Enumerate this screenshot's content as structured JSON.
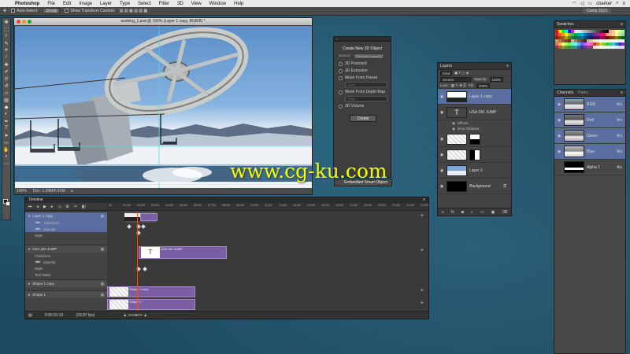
{
  "menubar": {
    "apple": "",
    "items": [
      "Photoshop",
      "File",
      "Edit",
      "Image",
      "Layer",
      "Type",
      "Select",
      "Filter",
      "3D",
      "View",
      "Window",
      "Help"
    ],
    "user": "cbarker"
  },
  "options": {
    "auto_select": "Auto-Select:",
    "auto_select_value": "Group",
    "show_transform": "Show Transform Controls",
    "workspace": "Comp 2015"
  },
  "document": {
    "title": "working_1.psd @ 100% (Layer 1 copy, RGB/8) *",
    "zoom": "100%",
    "doc_size": "Doc: 1.39M/6.91M"
  },
  "panel3d": {
    "title": "Create New 3D Object",
    "source_label": "Source:",
    "source_value": "Selected Layer(s)",
    "opt1": "3D Postcard",
    "opt2": "3D Extrusion",
    "opt3": "Mesh From Preset",
    "opt3_value": "Cone",
    "opt4": "Mesh From Depth Map",
    "opt4_value": "Plane",
    "opt5": "3D Volume",
    "create": "Create",
    "embedded": "Embedded Smart Object"
  },
  "layers": {
    "tab": "Layers",
    "kind": "Kind",
    "blend": "Screen",
    "opacity_label": "Opacity:",
    "opacity": "100%",
    "lock_label": "Lock:",
    "fill_label": "Fill:",
    "fill": "100%",
    "items": [
      {
        "name": "Layer 1 copy"
      },
      {
        "name": "USA SKI JUMP"
      },
      {
        "name": ""
      },
      {
        "name": ""
      },
      {
        "name": "Layer 1"
      },
      {
        "name": "Background"
      }
    ],
    "effects": "Effects",
    "drop_shadow": "Drop Shadow"
  },
  "swatches": {
    "tab": "Swatches",
    "colors": [
      "#ff0000",
      "#ffff00",
      "#00ff00",
      "#00ffff",
      "#0000ff",
      "#ff00ff",
      "#ffffff",
      "#e6e6e6",
      "#cccccc",
      "#b3b3b3",
      "#999999",
      "#808080",
      "#666666",
      "#4d4d4d",
      "#333333",
      "#1a1a1a",
      "#000000",
      "#ff9999",
      "#ffcc99",
      "#ffff99",
      "#ccff99",
      "#99ff99",
      "#ed1c24",
      "#f26522",
      "#f7941d",
      "#fff200",
      "#8dc63f",
      "#39b54a",
      "#00a651",
      "#00a99d",
      "#00aeef",
      "#0072bc",
      "#0054a6",
      "#2e3192",
      "#662d91",
      "#92278f",
      "#ec008c",
      "#ed145b",
      "#f69679",
      "#f9ad81",
      "#fdc68a",
      "#fff799",
      "#c4df9b",
      "#a3d39c",
      "#9e0b0f",
      "#a0410d",
      "#a36209",
      "#aba000",
      "#598527",
      "#197b30",
      "#007236",
      "#00746b",
      "#0076a3",
      "#004a80",
      "#003471",
      "#1b1464",
      "#440e62",
      "#630460",
      "#9e005d",
      "#9e0039",
      "#790000",
      "#7b2e00",
      "#7d4900",
      "#827b00",
      "#406618",
      "#005e20",
      "#c69c6d",
      "#a67c52",
      "#8c6239",
      "#754c24",
      "#603913",
      "#c7b299",
      "#998675",
      "#736357",
      "#534741",
      "#362f2d",
      "#c2b59b",
      "#d9c9a3",
      "#f0e6c8",
      "#ffe4e1",
      "#e0ffff",
      "#f5f5dc",
      "#fafad2",
      "#ffefd5",
      "#fff0f5",
      "#f0fff0",
      "#f0f8ff",
      "#fffaf0",
      "#ff6666",
      "#ffb366",
      "#ffff66",
      "#b3ff66",
      "#66ff66",
      "#66ffb3",
      "#66ffff",
      "#66b3ff",
      "#6666ff",
      "#b366ff",
      "#ff66ff",
      "#ff66b3",
      "#cc3333",
      "#cc8033",
      "#cccc33",
      "#80cc33",
      "#33cc33",
      "#33cc80",
      "#33cccc",
      "#3380cc",
      "#3333cc",
      "#8033cc",
      "#993333",
      "#996633",
      "#999933",
      "#669933",
      "#339933",
      "#339966",
      "#339999",
      "#336699",
      "#333399",
      "#663399",
      "#993399",
      "#993366",
      "#ffd9d9",
      "#ffecd9",
      "#ffffd9",
      "#ecffd9",
      "#d9ffd9",
      "#d9ffec",
      "#d9ffff",
      "#d9ecff",
      "#d9d9ff",
      "#ecd9ff"
    ]
  },
  "channels": {
    "tabs": [
      "Channels",
      "Paths"
    ],
    "items": [
      {
        "name": "RGB",
        "shortcut": "⌘2"
      },
      {
        "name": "Red",
        "shortcut": "⌘3"
      },
      {
        "name": "Green",
        "shortcut": "⌘4"
      },
      {
        "name": "Blue",
        "shortcut": "⌘5"
      },
      {
        "name": "Alpha 1",
        "shortcut": "⌘6"
      }
    ]
  },
  "timeline": {
    "title": "Timeline",
    "ruler": [
      "00",
      "01:00f",
      "02:00f",
      "03:00f",
      "04:00f",
      "05:00f",
      "06:00f",
      "07:00f",
      "08:00f",
      "09:00f",
      "10:00f",
      "11:00f",
      "12:00f",
      "13:00f",
      "14:00f",
      "15:00f",
      "16:00f",
      "17:00f",
      "18:00f",
      "19:00f",
      "20:00f",
      "21:00f",
      "22:00f"
    ],
    "tracks": {
      "layer1copy": "Layer 1 copy",
      "transform": "Transform",
      "opacity": "Opacity",
      "style": "Style",
      "usa": "USA SKI JUMP",
      "transform2": "Transform",
      "opacity2": "Opacity",
      "style2": "Style",
      "textwarp": "Text Warp",
      "shape1copy": "Shape 1 copy",
      "shape1": "Shape 1"
    },
    "clips": {
      "usa": "USA SKI JUMP",
      "shape1copy": "Shape 1 copy",
      "shape1": "Shape 1"
    },
    "timecode": "0:00:01:15",
    "fps": "(29.97 fps)"
  },
  "watermark": "www.cg-ku.com"
}
